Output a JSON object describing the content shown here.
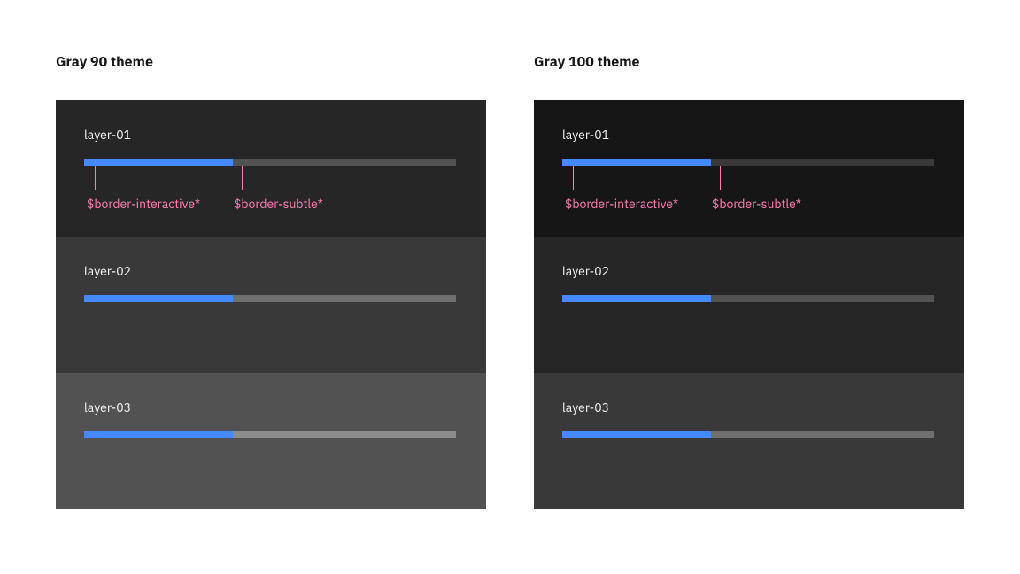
{
  "themes": [
    {
      "title": "Gray 90 theme",
      "layers": [
        {
          "label": "layer-01",
          "progress": 40
        },
        {
          "label": "layer-02",
          "progress": 40
        },
        {
          "label": "layer-03",
          "progress": 40
        }
      ]
    },
    {
      "title": "Gray 100 theme",
      "layers": [
        {
          "label": "layer-01",
          "progress": 40
        },
        {
          "label": "layer-02",
          "progress": 40
        },
        {
          "label": "layer-03",
          "progress": 40
        }
      ]
    }
  ],
  "tokens": {
    "interactive": "$border-interactive*",
    "subtle": "$border-subtle*"
  },
  "colors": {
    "interactive": "#4589ff",
    "annotation": "#ff7eb6",
    "g90": {
      "layer01": "#262626",
      "layer02": "#393939",
      "layer03": "#525252",
      "track01": "#525252",
      "track02": "#6f6f6f",
      "track03": "#8d8d8d"
    },
    "g100": {
      "layer01": "#161616",
      "layer02": "#262626",
      "layer03": "#393939",
      "track01": "#393939",
      "track02": "#525252",
      "track03": "#6f6f6f"
    }
  },
  "chart_data": [
    {
      "type": "bar",
      "title": "Gray 90 theme",
      "categories": [
        "layer-01",
        "layer-02",
        "layer-03"
      ],
      "values": [
        40,
        40,
        40
      ],
      "xlabel": "",
      "ylabel": "progress",
      "ylim": [
        0,
        100
      ]
    },
    {
      "type": "bar",
      "title": "Gray 100 theme",
      "categories": [
        "layer-01",
        "layer-02",
        "layer-03"
      ],
      "values": [
        40,
        40,
        40
      ],
      "xlabel": "",
      "ylabel": "progress",
      "ylim": [
        0,
        100
      ]
    }
  ]
}
